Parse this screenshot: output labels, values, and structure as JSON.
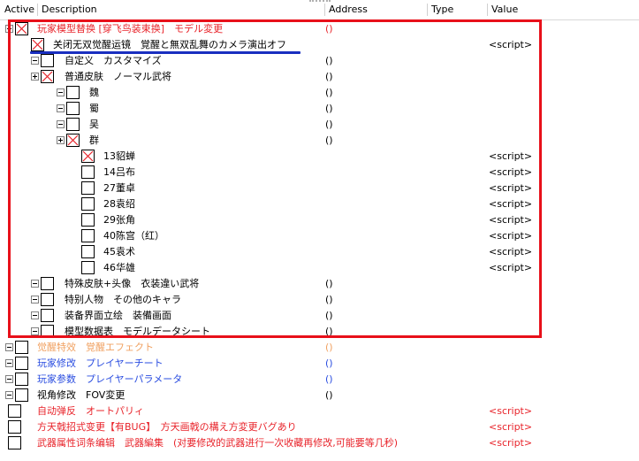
{
  "columns": {
    "active": "Active",
    "description": "Description",
    "address": "Address",
    "type": "Type",
    "value": "Value"
  },
  "colors": {
    "red": "#e8232a",
    "blue": "#2a4de0",
    "orange": "#f0a060",
    "highlight": "#e8101a",
    "underline": "#1a2fc0"
  },
  "rows": [
    {
      "desc": "玩家模型替换 [穿飞鸟装束换]　モデル変更",
      "addr": "()",
      "value": ""
    },
    {
      "desc": "关闭无双觉醒运镜　覚醒と無双乱舞のカメラ演出オフ",
      "addr": "",
      "value": "<script>"
    },
    {
      "desc": "自定义　カスタマイズ",
      "addr": "()",
      "value": ""
    },
    {
      "desc": "普通皮肤　ノーマル武将",
      "addr": "()",
      "value": ""
    },
    {
      "desc": "魏",
      "addr": "()",
      "value": ""
    },
    {
      "desc": "蜀",
      "addr": "()",
      "value": ""
    },
    {
      "desc": "吴",
      "addr": "()",
      "value": ""
    },
    {
      "desc": "群",
      "addr": "()",
      "value": ""
    },
    {
      "desc": "13貂蝉",
      "addr": "",
      "value": "<script>"
    },
    {
      "desc": "14吕布",
      "addr": "",
      "value": "<script>"
    },
    {
      "desc": "27董卓",
      "addr": "",
      "value": "<script>"
    },
    {
      "desc": "28袁绍",
      "addr": "",
      "value": "<script>"
    },
    {
      "desc": "29张角",
      "addr": "",
      "value": "<script>"
    },
    {
      "desc": "40陈宫（红）",
      "addr": "",
      "value": "<script>"
    },
    {
      "desc": "45袁术",
      "addr": "",
      "value": "<script>"
    },
    {
      "desc": "46华雄",
      "addr": "",
      "value": "<script>"
    },
    {
      "desc": "特殊皮肤+头像　衣装違い武将",
      "addr": "()",
      "value": ""
    },
    {
      "desc": "特别人物　その他のキャラ",
      "addr": "()",
      "value": ""
    },
    {
      "desc": "装备界面立绘　装備画面",
      "addr": "()",
      "value": ""
    },
    {
      "desc": "模型数据表　モデルデータシート",
      "addr": "()",
      "value": ""
    },
    {
      "desc": "觉醒特效　覚醒エフェクト",
      "addr": "()",
      "value": ""
    },
    {
      "desc": "玩家修改　プレイヤーチート",
      "addr": "()",
      "value": ""
    },
    {
      "desc": "玩家参数　プレイヤーパラメータ",
      "addr": "()",
      "value": ""
    },
    {
      "desc": "视角修改　FOV変更",
      "addr": "()",
      "value": ""
    },
    {
      "desc": "自动弹反　オートパリィ",
      "addr": "",
      "value": "<script>"
    },
    {
      "desc": "方天戟招式变更【有BUG】　方天画戟の構え方変更バグあり",
      "addr": "",
      "value": "<script>"
    },
    {
      "desc": "武器属性词条编辑　武器編集　(对要修改的武器进行一次收藏再修改,可能要等几秒)",
      "addr": "",
      "value": "<script>"
    }
  ]
}
